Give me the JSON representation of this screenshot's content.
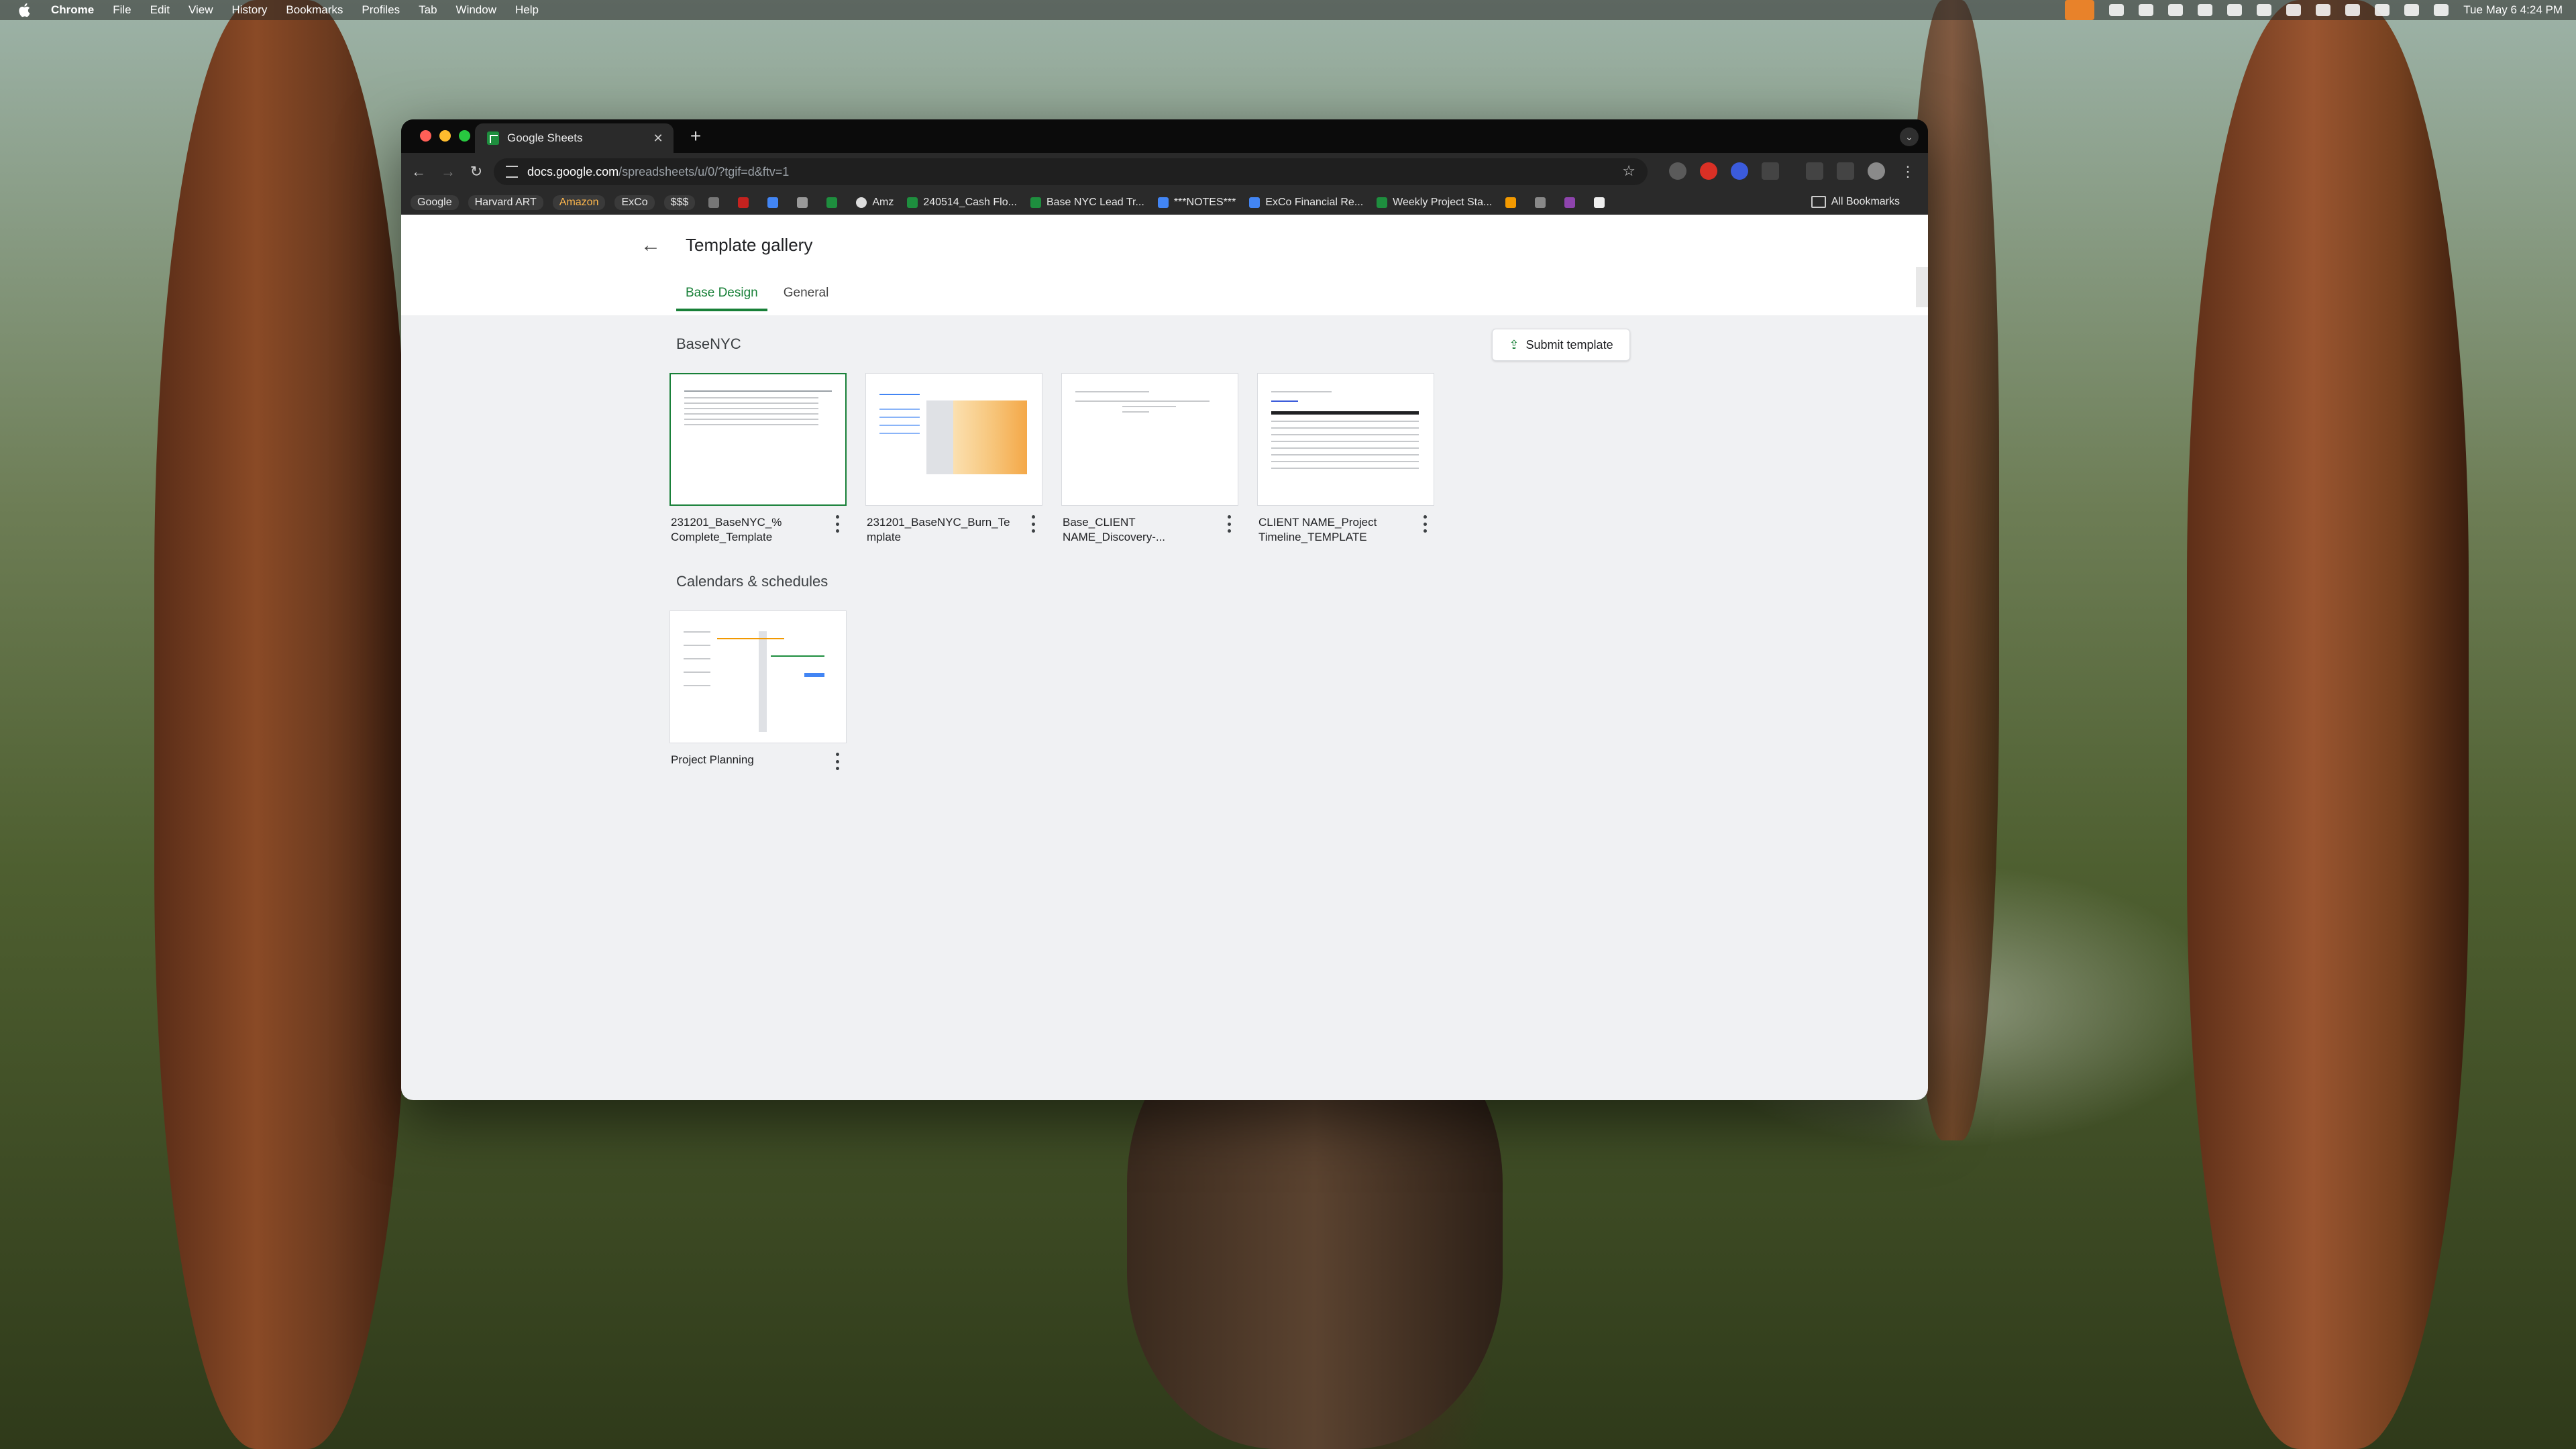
{
  "menubar": {
    "app": "Chrome",
    "items": [
      "File",
      "Edit",
      "View",
      "History",
      "Bookmarks",
      "Profiles",
      "Tab",
      "Window",
      "Help"
    ],
    "clock": "Tue May 6  4:24 PM"
  },
  "browser": {
    "tab_title": "Google Sheets",
    "url_host": "docs.google.com",
    "url_path": "/spreadsheets/u/0/?tgif=d&ftv=1",
    "bookmarks": [
      {
        "label": "Google",
        "chip": true
      },
      {
        "label": "Harvard ART",
        "chip": true
      },
      {
        "label": "Amazon",
        "chip": true
      },
      {
        "label": "ExCo",
        "chip": true
      },
      {
        "label": "$$$",
        "chip": true
      },
      {
        "label": "Amz",
        "chip": false
      },
      {
        "label": "240514_Cash Flo...",
        "chip": false
      },
      {
        "label": "Base NYC Lead Tr...",
        "chip": false
      },
      {
        "label": "***NOTES***",
        "chip": false
      },
      {
        "label": "ExCo Financial Re...",
        "chip": false
      },
      {
        "label": "Weekly Project Sta...",
        "chip": false
      }
    ],
    "all_bookmarks": "All Bookmarks"
  },
  "gallery": {
    "title": "Template gallery",
    "tabs": [
      "Base Design",
      "General"
    ],
    "active_tab": "Base Design",
    "submit_label": "Submit template",
    "sections": [
      {
        "title": "BaseNYC",
        "templates": [
          {
            "line1": "231201_BaseNYC_%",
            "line2": "Complete_Template"
          },
          {
            "line1": "231201_BaseNYC_Burn_Te",
            "line2": "mplate"
          },
          {
            "line1": "Base_CLIENT",
            "line2": "NAME_Discovery-..."
          },
          {
            "line1": "CLIENT NAME_Project",
            "line2": "Timeline_TEMPLATE"
          }
        ]
      },
      {
        "title": "Calendars & schedules",
        "templates": [
          {
            "line1": "Project Planning",
            "line2": ""
          }
        ]
      }
    ]
  },
  "colors": {
    "accent": "#188038",
    "sheets_green": "#1e8e3e",
    "mic_orange": "#e8822a"
  }
}
